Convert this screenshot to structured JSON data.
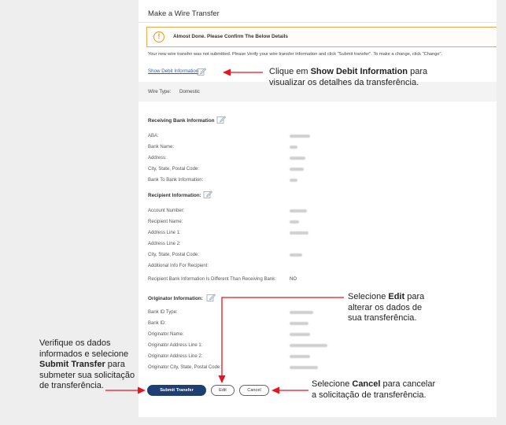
{
  "page": {
    "title": "Make a Wire Transfer",
    "alert": "Almost Done. Please Confirm The Below Details",
    "notice": "Your new wire transfer was not submitted. Please Verify your wire transfer information and click \"Submit transfer\". To make a change, click \"Change\".",
    "debit_link": "Show Debit Information",
    "wire_type_label": "Wire Type:",
    "wire_type_value": "Domestic"
  },
  "receiving_bank": {
    "title": "Receiving Bank Information",
    "rows": [
      "ABA:",
      "Bank Name:",
      "Address:",
      "City, State, Postal Code:",
      "Bank To Bank Information:"
    ]
  },
  "recipient": {
    "title": "Recipient Information:",
    "rows": [
      "Account Number:",
      "Recipient Name:",
      "Address Line 1:",
      "Address Line 2:",
      "City, State, Postal Code:",
      "Additional Info For Recipient:"
    ],
    "different_label": "Recipient Bank Information Is Different Than Receiving Bank:",
    "different_value": "NO"
  },
  "originator": {
    "title": "Originator Information:",
    "rows": [
      "Bank ID Type:",
      "Bank ID:",
      "Originator Name:",
      "Originator Address Line 1:",
      "Originator Address Line 2:",
      "Originator City, State, Postal Code:"
    ]
  },
  "buttons": {
    "submit": "Submit Transfer",
    "edit": "Edit",
    "cancel": "Cancel"
  },
  "callouts": {
    "debit_pre": "Clique em ",
    "debit_bold": "Show Debit Information",
    "debit_post": " para",
    "debit_line2": "visualizar os detalhes da transferência.",
    "edit_pre": "Selecione ",
    "edit_bold": "Edit",
    "edit_post": " para",
    "edit_line2": "alterar os dados de",
    "edit_line3": "sua transferência.",
    "submit_line1": "Verifique os dados",
    "submit_line2": "informados e selecione",
    "submit_bold": "Submit Transfer",
    "submit_post": " para",
    "submit_line4": "submeter sua solicitação",
    "submit_line5": "de transferência.",
    "cancel_pre": "Selecione ",
    "cancel_bold": "Cancel",
    "cancel_post": " para cancelar",
    "cancel_line2": "a solicitação de transferência."
  },
  "colors": {
    "accent": "#1f3f73",
    "alert_border": "#f0a64a",
    "link": "#2a5ea8",
    "arrow": "#e8141e"
  }
}
